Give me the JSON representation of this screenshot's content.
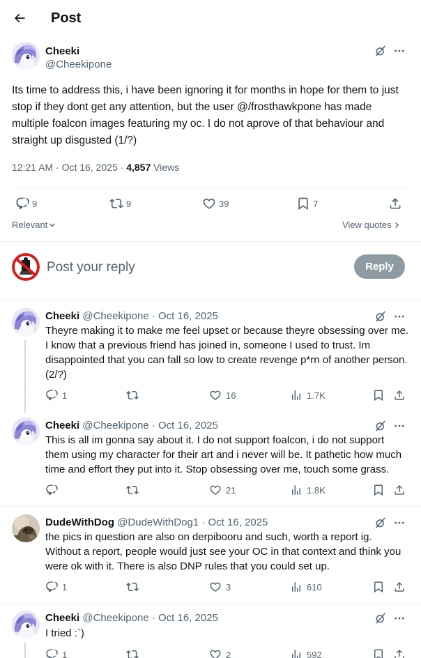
{
  "header": {
    "title": "Post"
  },
  "post": {
    "author_name": "Cheeki",
    "author_handle": "@Cheekipone",
    "text": "Its time to address this, i have been ignoring it for months in hope for them to just stop if they dont get any attention, but the user @/frosthawkpone has made multiple foalcon images featuring my oc. I do not aprove of that behaviour and straight up disgusted (1/?)",
    "time": "12:21 AM · Oct 16, 2025 · ",
    "views_count": "4,857",
    "views_label": " Views",
    "replies": "9",
    "reposts": "9",
    "likes": "39",
    "bookmarks": "7"
  },
  "sort": {
    "relevant_label": "Relevant",
    "view_quotes_label": "View quotes"
  },
  "composer": {
    "placeholder": "Post your reply",
    "button_label": "Reply"
  },
  "replies": [
    {
      "name": "Cheeki",
      "handle": "@Cheekipone",
      "date": "Oct 16, 2025",
      "text": "Theyre making it to make me feel upset or because theyre obsessing over me. I know that a previous friend has joined in, someone I used to trust. Im disappointed that you can fall so low to create revenge p*rn of another person. (2/?)",
      "replies": "1",
      "reposts": "",
      "likes": "16",
      "views": "1.7K"
    },
    {
      "name": "Cheeki",
      "handle": "@Cheekipone",
      "date": "Oct 16, 2025",
      "text": "This is all im gonna say about it. I do not support foalcon, i do not support them using my character for their art and i never will be. It pathetic how much time and effort they put into it. Stop obsessing over me, touch some grass.",
      "replies": "",
      "reposts": "",
      "likes": "21",
      "views": "1.8K"
    },
    {
      "name": "DudeWithDog",
      "handle": "@DudeWithDog1",
      "date": "Oct 16, 2025",
      "text": "the pics in question are also on derpibooru and such, worth a report ig. Without a report, people would just see your OC in that context and think you were ok with it. There is also DNP rules that you could set up.",
      "replies": "1",
      "reposts": "",
      "likes": "3",
      "views": "610"
    },
    {
      "name": "Cheeki",
      "handle": "@Cheekipone",
      "date": "Oct 16, 2025",
      "text": "I tried :`)",
      "replies": "1",
      "reposts": "",
      "likes": "2",
      "views": "592"
    }
  ],
  "separator": " · ",
  "colors": {
    "accent": "#1d9bf0",
    "text": "#0f1419",
    "muted": "#536471",
    "divider": "#eff3f4",
    "reply_button": "#8e9ba3"
  }
}
